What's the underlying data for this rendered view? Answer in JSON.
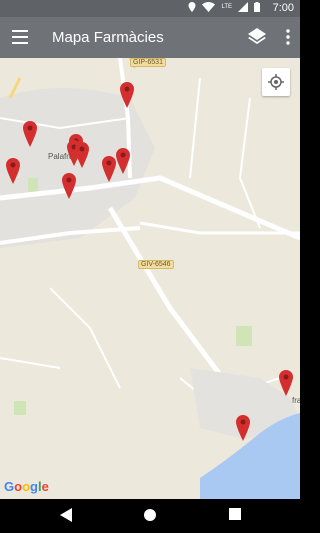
{
  "status": {
    "time": "7:00",
    "network": "LTE"
  },
  "appbar": {
    "title": "Mapa Farmàcies",
    "menu_icon": "menu-icon",
    "layers_icon": "layers-icon",
    "more_icon": "more-vert-icon"
  },
  "map": {
    "town_label": "Palamos / Palafrugell",
    "town_visible": "Palafrugell",
    "road_labels": [
      "GIP-6531",
      "GIV-6546"
    ],
    "side_label": "fra",
    "brand": "Google",
    "pin_color": "#d32f2f",
    "pin_count": 11
  },
  "navbar": {
    "back_icon": "back-icon",
    "home_icon": "home-icon",
    "recents_icon": "recents-icon"
  }
}
